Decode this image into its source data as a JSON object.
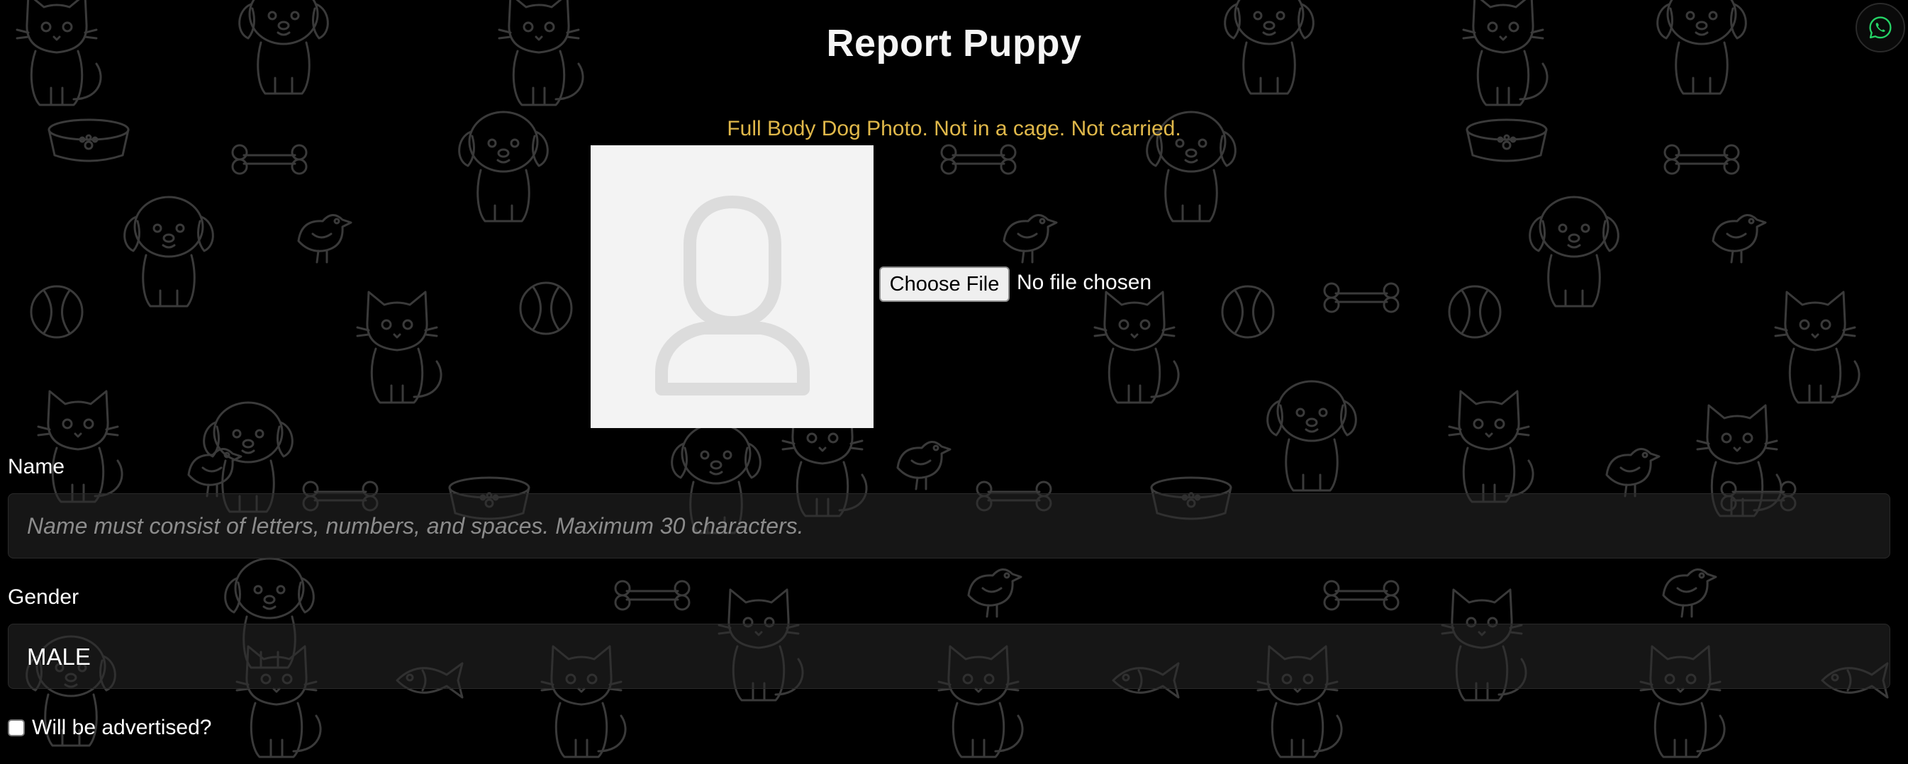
{
  "page": {
    "title": "Report Puppy"
  },
  "photo": {
    "hint": "Full Body Dog Photo. Not in a cage. Not carried.",
    "placeholder_icon": "avatar-placeholder-icon",
    "choose_file_label": "Choose File",
    "file_status": "No file chosen"
  },
  "form": {
    "name_label": "Name",
    "name_value": "",
    "name_placeholder": "Name must consist of letters, numbers, and spaces. Maximum 30 characters.",
    "gender_label": "Gender",
    "gender_value": "MALE",
    "advertise_label": "Will be advertised?",
    "advertise_checked": false
  },
  "floating": {
    "whatsapp_icon": "whatsapp-icon",
    "whatsapp_color": "#25d366"
  },
  "colors": {
    "background": "#000000",
    "hint": "#e0b84a",
    "doodle_stroke": "#7a7a7a"
  },
  "background_pattern_icons": [
    "puppy-icon",
    "cat-icon",
    "bone-icon",
    "ball-icon",
    "bird-icon",
    "food-bowl-icon",
    "fish-icon"
  ]
}
